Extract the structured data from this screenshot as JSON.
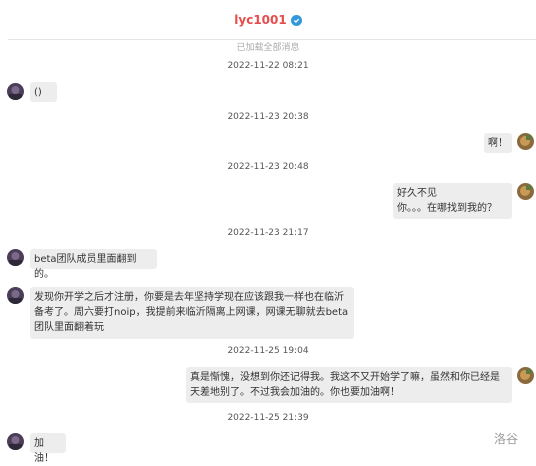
{
  "header": {
    "title": "lyc1001",
    "verified_icon": "verified-check-icon",
    "loaded_text": "已加载全部消息"
  },
  "colors": {
    "title": "#e74c4c",
    "verified": "#3498db",
    "bubble": "#ededed"
  },
  "messages": {
    "m1": {
      "time": "2022-11-22 08:21",
      "text": "()",
      "side": "left"
    },
    "m2": {
      "time": "2022-11-23 20:38",
      "text": "啊！",
      "side": "right"
    },
    "m3": {
      "time": "2022-11-23 20:48",
      "text": "好久不见\n你。。。在哪找到我的？",
      "side": "right"
    },
    "m4": {
      "time": "2022-11-23 21:17",
      "text": "beta团队成员里面翻到的。",
      "side": "left"
    },
    "m5": {
      "text": "发现你开学之后才注册，你要是去年坚持学现在应该跟我一样也在临沂\n备考了。周六要打noip，我提前来临沂隔离上网课，网课无聊就去beta\n团队里面翻着玩",
      "side": "left"
    },
    "m6": {
      "time": "2022-11-25 19:04",
      "text": "真是惭愧，没想到你还记得我。我这不又开始学了嘛，虽然和你已经是\n天差地别了。不过我会加油的。你也要加油啊！",
      "side": "right"
    },
    "m7": {
      "time": "2022-11-25 21:39",
      "text": "加油！",
      "side": "left"
    }
  },
  "watermark": "洛谷"
}
